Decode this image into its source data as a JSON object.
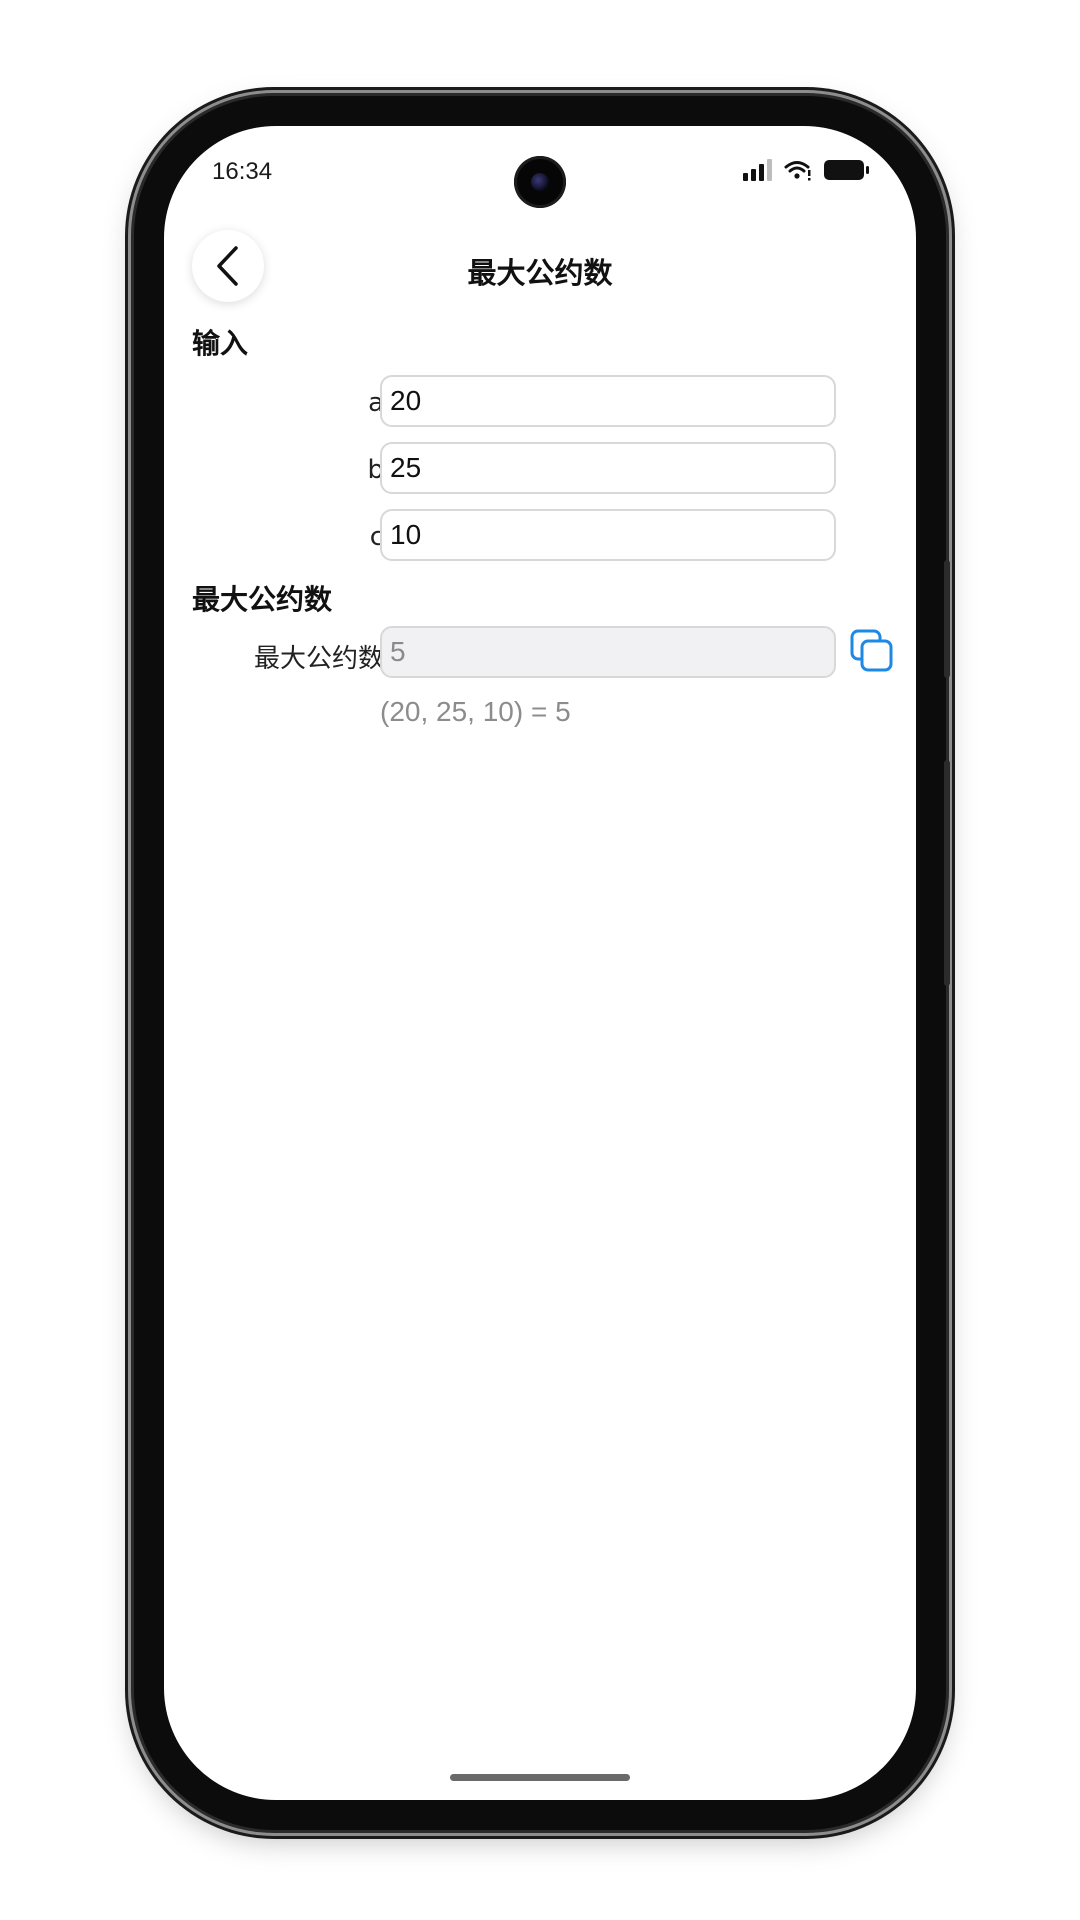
{
  "status_bar": {
    "time": "16:34"
  },
  "header": {
    "back_icon": "chevron-left-icon",
    "title": "最大公约数"
  },
  "input_section": {
    "title": "输入",
    "fields": [
      {
        "label": "a",
        "value": "20"
      },
      {
        "label": "b",
        "value": "25"
      },
      {
        "label": "c",
        "value": "10"
      }
    ]
  },
  "result_section": {
    "title": "最大公约数",
    "label": "最大公约数",
    "value": "5",
    "copy_icon": "copy-icon",
    "formula": "(20, 25, 10) = 5"
  },
  "colors": {
    "accent": "#1e88e5",
    "field_border": "#d8d8d8",
    "readonly_bg": "#f1f1f4",
    "muted_text": "#8c8c8c"
  }
}
